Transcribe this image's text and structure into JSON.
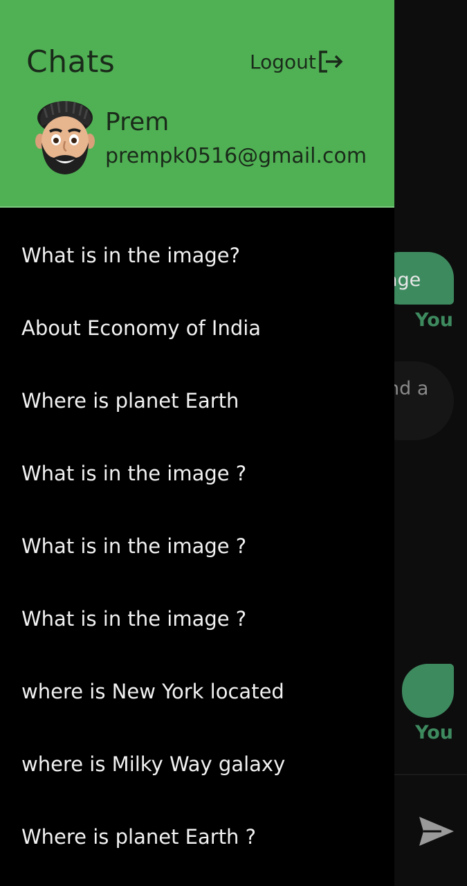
{
  "drawer": {
    "title": "Chats",
    "logout_label": "Logout",
    "user": {
      "name": "Prem",
      "email": "prempk0516@gmail.com"
    },
    "chats": [
      {
        "label": "What is in the image?"
      },
      {
        "label": "About Economy of India"
      },
      {
        "label": "Where is planet Earth"
      },
      {
        "label": "What is in the image ?"
      },
      {
        "label": "What is in the image ?"
      },
      {
        "label": "What is in the image ?"
      },
      {
        "label": "where is New York located"
      },
      {
        "label": "where is Milky Way galaxy"
      },
      {
        "label": "Where is planet Earth ?"
      }
    ]
  },
  "background": {
    "message_fragment_1": "age",
    "message_fragment_2": "nd a",
    "sender_label": "You"
  },
  "colors": {
    "header_green": "#50b154",
    "bubble_green": "#3e8a5f",
    "drawer_bg": "#000000"
  }
}
